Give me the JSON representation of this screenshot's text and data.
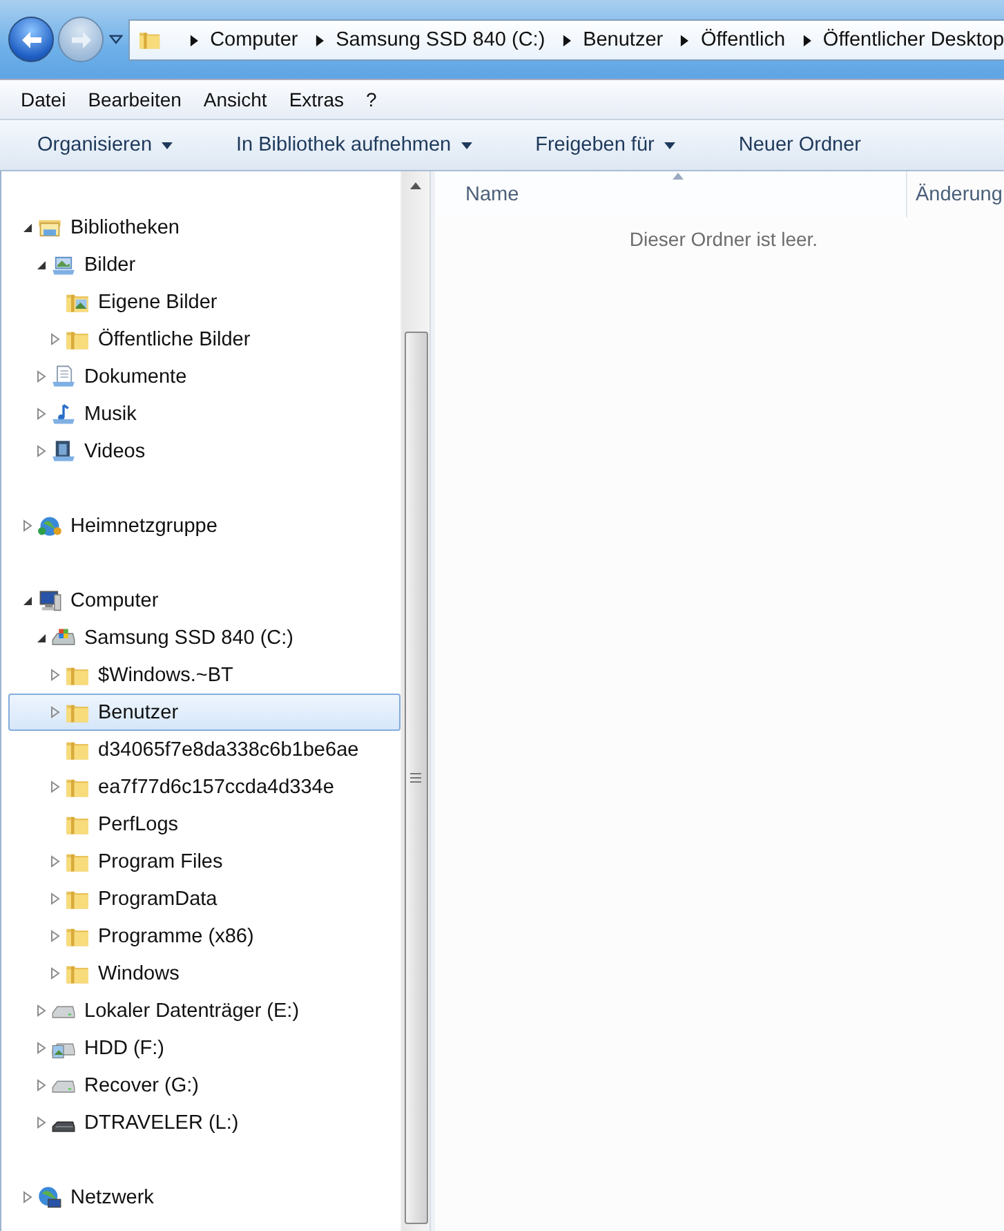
{
  "navigation": {
    "back": {
      "disabled": false
    },
    "forward": {
      "disabled": true
    }
  },
  "address": {
    "crumbs": [
      "Computer",
      "Samsung SSD 840 (C:)",
      "Benutzer",
      "Öffentlich",
      "Öffentlicher Desktop"
    ]
  },
  "menu_bar": [
    "Datei",
    "Bearbeiten",
    "Ansicht",
    "Extras",
    "?"
  ],
  "command_bar": [
    {
      "label": "Organisieren",
      "dropdown": true
    },
    {
      "label": "In Bibliothek aufnehmen",
      "dropdown": true
    },
    {
      "label": "Freigeben für",
      "dropdown": true
    },
    {
      "label": "Neuer Ordner",
      "dropdown": false
    }
  ],
  "nav_tree": [
    {
      "label": "Bibliotheken",
      "kind": "library",
      "expanded": true,
      "selected": false,
      "children": [
        {
          "label": "Bilder",
          "kind": "pictures",
          "expanded": true,
          "selected": false,
          "children": [
            {
              "label": "Eigene Bilder",
              "kind": "picture-folder",
              "selected": false
            },
            {
              "label": "Öffentliche Bilder",
              "kind": "folder",
              "expanded": false,
              "selected": false
            }
          ]
        },
        {
          "label": "Dokumente",
          "kind": "documents",
          "expanded": false,
          "selected": false
        },
        {
          "label": "Musik",
          "kind": "music",
          "expanded": false,
          "selected": false
        },
        {
          "label": "Videos",
          "kind": "videos",
          "expanded": false,
          "selected": false
        }
      ]
    },
    {
      "label": "Heimnetzgruppe",
      "kind": "homegroup",
      "expanded": false,
      "selected": false
    },
    {
      "label": "Computer",
      "kind": "computer",
      "expanded": true,
      "selected": false,
      "children": [
        {
          "label": "Samsung SSD 840 (C:)",
          "kind": "system-drive",
          "expanded": true,
          "selected": false,
          "children": [
            {
              "label": "$Windows.~BT",
              "kind": "folder",
              "expanded": false,
              "selected": false
            },
            {
              "label": "Benutzer",
              "kind": "folder",
              "expanded": false,
              "selected": true
            },
            {
              "label": "d34065f7e8da338c6b1be6ae",
              "kind": "folder",
              "selected": false
            },
            {
              "label": "ea7f77d6c157ccda4d334e",
              "kind": "folder",
              "expanded": false,
              "selected": false
            },
            {
              "label": "PerfLogs",
              "kind": "folder",
              "selected": false
            },
            {
              "label": "Program Files",
              "kind": "folder",
              "expanded": false,
              "selected": false
            },
            {
              "label": "ProgramData",
              "kind": "folder",
              "expanded": false,
              "selected": false
            },
            {
              "label": "Programme (x86)",
              "kind": "folder",
              "expanded": false,
              "selected": false
            },
            {
              "label": "Windows",
              "kind": "folder",
              "expanded": false,
              "selected": false
            }
          ]
        },
        {
          "label": "Lokaler Datenträger (E:)",
          "kind": "drive",
          "expanded": false,
          "selected": false
        },
        {
          "label": "HDD (F:)",
          "kind": "picture-drive",
          "expanded": false,
          "selected": false
        },
        {
          "label": "Recover (G:)",
          "kind": "drive",
          "expanded": false,
          "selected": false
        },
        {
          "label": "DTRAVELER (L:)",
          "kind": "usb-drive",
          "expanded": false,
          "selected": false
        }
      ]
    },
    {
      "label": "Netzwerk",
      "kind": "network",
      "expanded": false,
      "selected": false
    }
  ],
  "content": {
    "columns": [
      {
        "label": "Name",
        "sorted": true
      },
      {
        "label": "Änderung",
        "sorted": false
      }
    ],
    "empty_message": "Dieser Ordner ist leer."
  }
}
